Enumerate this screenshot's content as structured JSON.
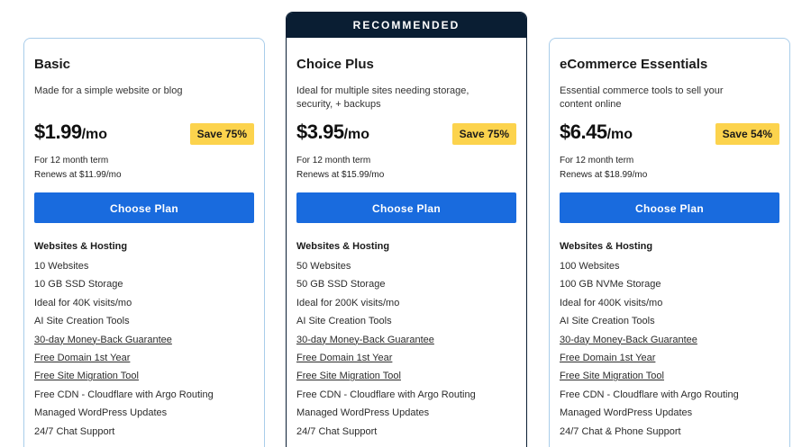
{
  "plans": [
    {
      "name": "Basic",
      "description": "Made for a simple website or blog",
      "price": "$1.99",
      "period": "/mo",
      "save": "Save 75%",
      "term": "For 12 month term",
      "renews": "Renews at $11.99/mo",
      "cta": "Choose Plan",
      "features_title": "Websites & Hosting",
      "features": [
        {
          "text": "10 Websites",
          "link": false
        },
        {
          "text": "10 GB SSD Storage",
          "link": false
        },
        {
          "text": "Ideal for 40K visits/mo",
          "link": false
        },
        {
          "text": "AI Site Creation Tools",
          "link": false
        },
        {
          "text": "30-day Money-Back Guarantee",
          "link": true
        },
        {
          "text": "Free Domain 1st Year",
          "link": true
        },
        {
          "text": "Free Site Migration Tool",
          "link": true
        },
        {
          "text": "Free CDN - Cloudflare with Argo Routing",
          "link": false
        },
        {
          "text": "Managed WordPress Updates",
          "link": false
        },
        {
          "text": "24/7 Chat Support",
          "link": false
        }
      ]
    },
    {
      "banner": "RECOMMENDED",
      "name": "Choice Plus",
      "description": "Ideal for multiple sites needing storage, security, + backups",
      "price": "$3.95",
      "period": "/mo",
      "save": "Save 75%",
      "term": "For 12 month term",
      "renews": "Renews at $15.99/mo",
      "cta": "Choose Plan",
      "features_title": "Websites & Hosting",
      "features": [
        {
          "text": "50 Websites",
          "link": false
        },
        {
          "text": "50 GB SSD Storage",
          "link": false
        },
        {
          "text": "Ideal for 200K visits/mo",
          "link": false
        },
        {
          "text": "AI Site Creation Tools",
          "link": false
        },
        {
          "text": "30-day Money-Back Guarantee",
          "link": true
        },
        {
          "text": "Free Domain 1st Year",
          "link": true
        },
        {
          "text": "Free Site Migration Tool",
          "link": true
        },
        {
          "text": "Free CDN - Cloudflare with Argo Routing",
          "link": false
        },
        {
          "text": "Managed WordPress Updates",
          "link": false
        },
        {
          "text": "24/7 Chat Support",
          "link": false
        }
      ]
    },
    {
      "name": "eCommerce Essentials",
      "description": "Essential commerce tools to sell your content online",
      "price": "$6.45",
      "period": "/mo",
      "save": "Save 54%",
      "term": "For 12 month term",
      "renews": "Renews at $18.99/mo",
      "cta": "Choose Plan",
      "features_title": "Websites & Hosting",
      "features": [
        {
          "text": "100 Websites",
          "link": false
        },
        {
          "text": "100 GB NVMe Storage",
          "link": false
        },
        {
          "text": "Ideal for 400K visits/mo",
          "link": false
        },
        {
          "text": "AI Site Creation Tools",
          "link": false
        },
        {
          "text": "30-day Money-Back Guarantee",
          "link": true
        },
        {
          "text": "Free Domain 1st Year",
          "link": true
        },
        {
          "text": "Free Site Migration Tool",
          "link": true
        },
        {
          "text": "Free CDN - Cloudflare with Argo Routing",
          "link": false
        },
        {
          "text": "Managed WordPress Updates",
          "link": false
        },
        {
          "text": "24/7 Chat & Phone Support",
          "link": false
        }
      ]
    }
  ],
  "colors": {
    "accent": "#196bde",
    "save_badge": "#fcd34d",
    "banner": "#0a1e33",
    "card_border": "#a9cdea"
  }
}
